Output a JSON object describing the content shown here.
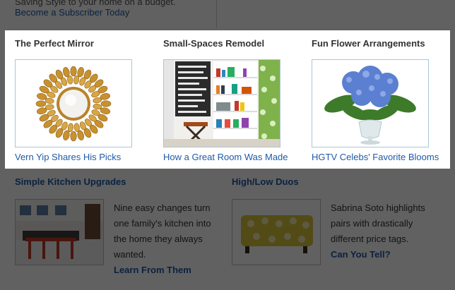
{
  "top": {
    "partial_text": "Saving Style to your home on a budget.",
    "subscribe_link": "Become a Subscriber Today"
  },
  "features": [
    {
      "title": "The Perfect Mirror",
      "link": "Vern Yip Shares His Picks",
      "image_icon": "sunburst-mirror-image"
    },
    {
      "title": "Small-Spaces Remodel",
      "link": "How a Great Room Was Made",
      "image_icon": "bookshelf-room-image"
    },
    {
      "title": "Fun Flower Arrangements",
      "link": "HGTV Celebs' Favorite Blooms",
      "image_icon": "hydrangea-vase-image"
    }
  ],
  "lower": [
    {
      "title": "Simple Kitchen Upgrades",
      "lines": [
        "Nine easy changes turn",
        "one family's kitchen into",
        "the home they always",
        "wanted."
      ],
      "link": "Learn From Them",
      "image_icon": "kitchen-image"
    },
    {
      "title": "High/Low Duos",
      "lines": [
        "Sabrina Soto highlights",
        "pairs with drastically",
        "different price tags."
      ],
      "link": "Can You Tell?",
      "image_icon": "ottoman-image"
    }
  ],
  "colors": {
    "link": "#1d5aa8",
    "overlay": "rgba(0,0,0,0.62)",
    "thumb_border": "#a9c6d9"
  }
}
